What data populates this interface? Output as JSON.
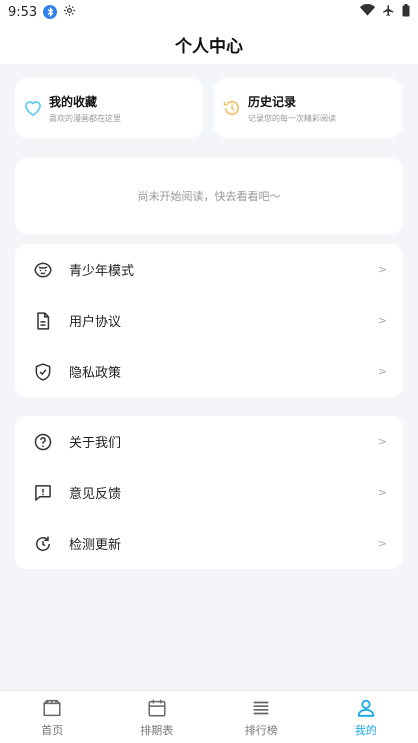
{
  "status": {
    "time": "9:53"
  },
  "header": {
    "title": "个人中心"
  },
  "quick": {
    "favorites": {
      "title": "我的收藏",
      "subtitle": "喜欢的漫画都在这里"
    },
    "history": {
      "title": "历史记录",
      "subtitle": "记录您的每一次精彩阅读"
    }
  },
  "empty": {
    "text": "尚未开始阅读，快去看看吧～"
  },
  "menu1": [
    {
      "label": "青少年模式",
      "icon": "teen-mode-icon",
      "arrow": ">"
    },
    {
      "label": "用户协议",
      "icon": "document-icon",
      "arrow": ">"
    },
    {
      "label": "隐私政策",
      "icon": "shield-check-icon",
      "arrow": ">"
    }
  ],
  "menu2": [
    {
      "label": "关于我们",
      "icon": "help-circle-icon",
      "arrow": ">"
    },
    {
      "label": "意见反馈",
      "icon": "feedback-icon",
      "arrow": ">"
    },
    {
      "label": "检测更新",
      "icon": "refresh-icon",
      "arrow": ">"
    }
  ],
  "tabs": [
    {
      "label": "首页",
      "icon": "home-icon"
    },
    {
      "label": "排期表",
      "icon": "calendar-icon"
    },
    {
      "label": "排行榜",
      "icon": "ranking-icon"
    },
    {
      "label": "我的",
      "icon": "user-icon",
      "active": true
    }
  ],
  "colors": {
    "accent": "#1aa9e8",
    "favorite": "#5cc8f5",
    "history": "#f3c06b",
    "background": "#f4f5f9"
  }
}
